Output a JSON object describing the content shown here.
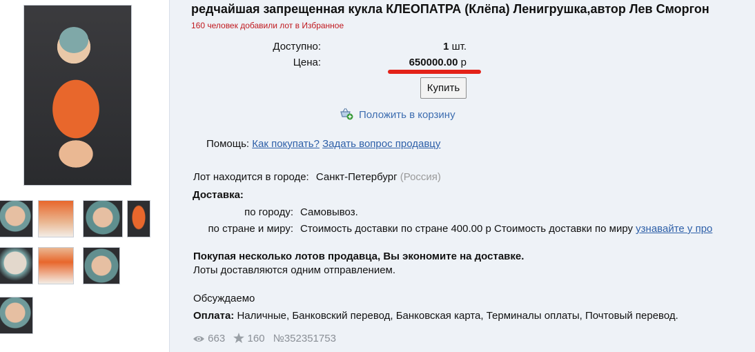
{
  "title": "редчайшая запрещенная кукла КЛЕОПАТРА (Клёпа) Ленигрушка,автор Лев Сморгон",
  "favorites_text": "160 человек добавили лот в Избранное",
  "available": {
    "label": "Доступно:",
    "qty": "1",
    "unit": "шт."
  },
  "price": {
    "label": "Цена:",
    "amount": "650000.00",
    "currency": "р"
  },
  "buy_label": "Купить",
  "cart_link": "Положить в корзину",
  "help": {
    "label": "Помощь:",
    "link1": "Как покупать?",
    "link2": "Задать вопрос продавцу"
  },
  "location": {
    "label": "Лот находится в городе:",
    "city": "Санкт-Петербург",
    "country": "(Россия)"
  },
  "delivery": {
    "heading": "Доставка:",
    "city_label": "по городу:",
    "city_value": "Самовывоз.",
    "world_label": "по стране и миру:",
    "world_value": "Стоимость доставки по стране 400.00 р Стоимость доставки по миру",
    "world_link": "узнавайте у про"
  },
  "savings": {
    "bold": "Покупая несколько лотов продавца, Вы экономите на доставке.",
    "normal": "Лоты доставляются одним отправлением."
  },
  "negotiable": "Обсуждаемо",
  "payment": {
    "label": "Оплата:",
    "value": "Наличные, Банковский перевод, Банковская карта, Терминалы оплаты, Почтовый перевод."
  },
  "stats": {
    "views": "663",
    "stars": "160",
    "lot_number": "№352351753"
  },
  "icons": [
    "eye-icon",
    "star-icon",
    "cart-add-icon"
  ],
  "colors": {
    "accent_red": "#e32219",
    "link_blue": "#2d5fa8",
    "favorites_red": "#c0181e"
  }
}
